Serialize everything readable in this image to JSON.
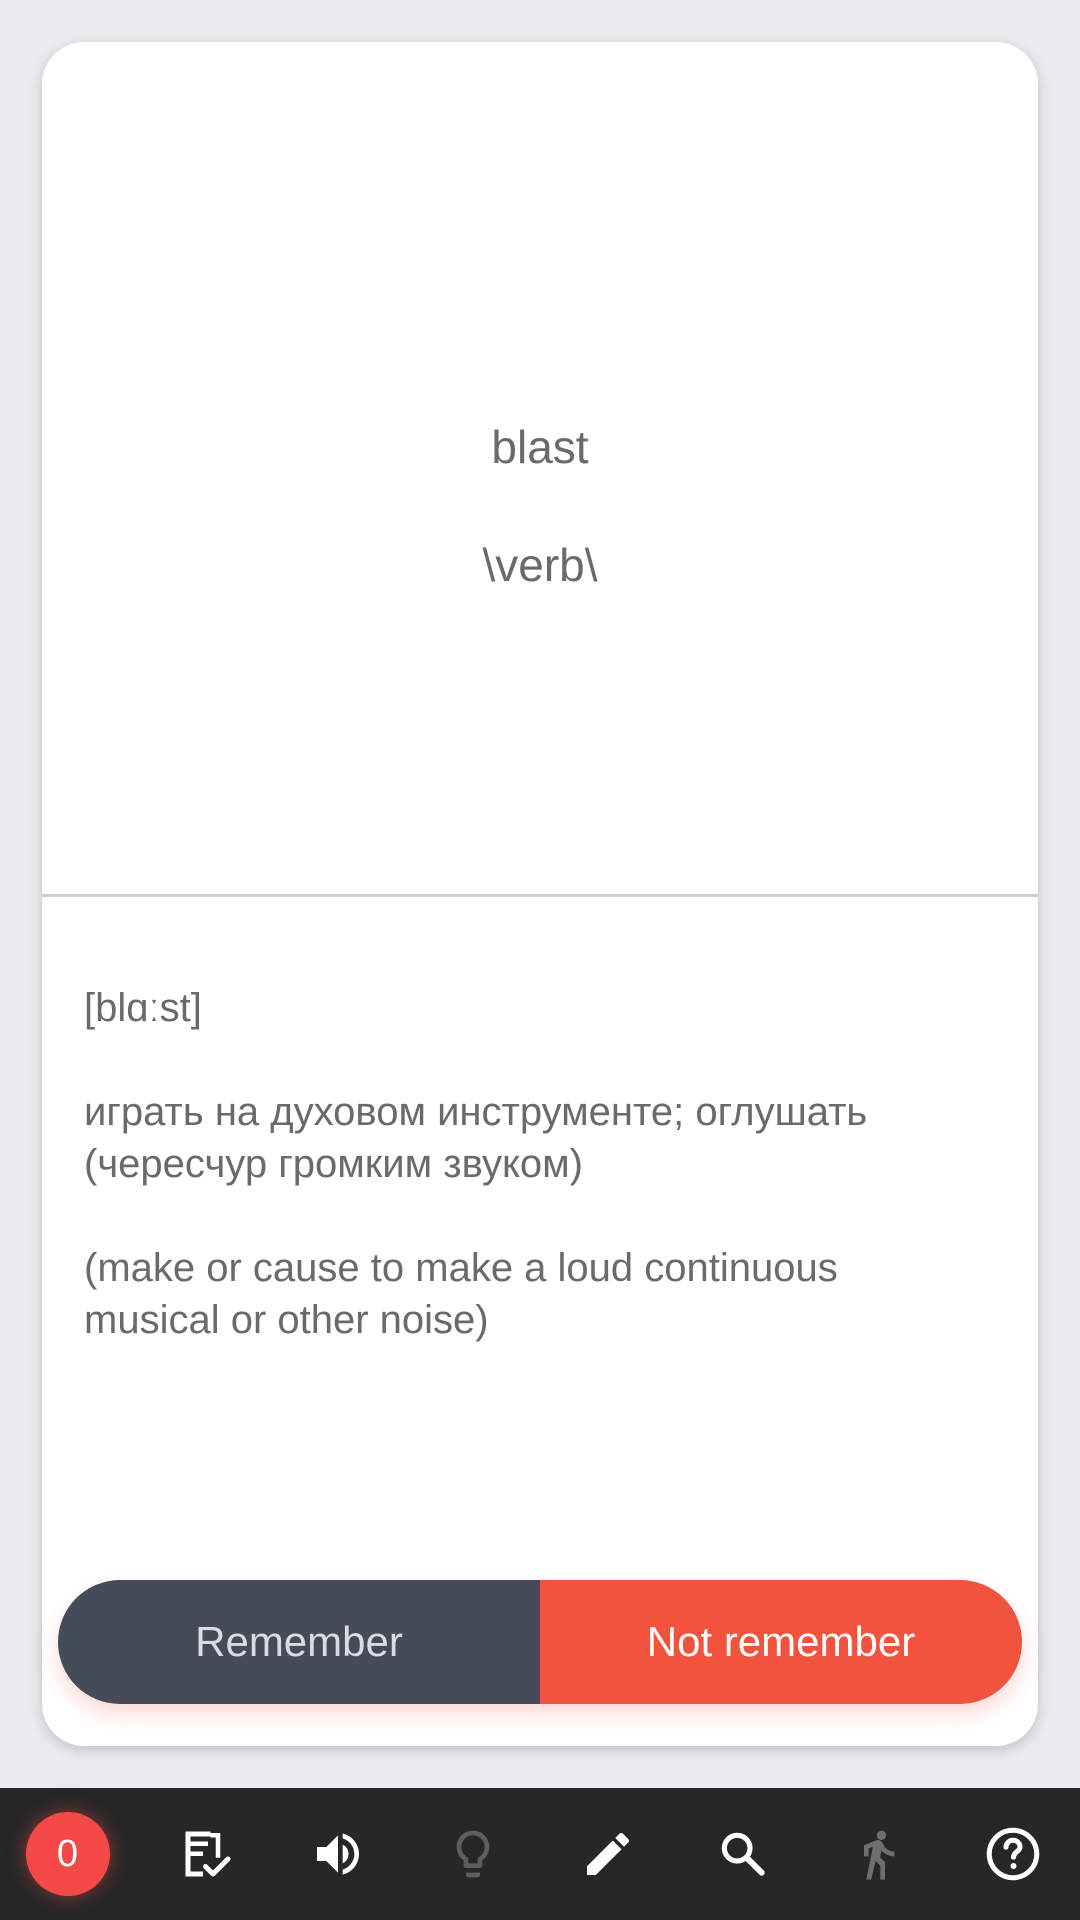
{
  "card": {
    "word": "blast",
    "part_of_speech": "\\verb\\",
    "transcription": "[blɑːst]",
    "translation": "играть на духовом инструменте; оглушать (чересчур громким звуком)",
    "definition": "(make or cause to make a loud continuous musical or other noise)"
  },
  "actions": {
    "remember_label": "Remember",
    "not_remember_label": "Not remember"
  },
  "toolbar": {
    "counter_value": "0",
    "icons": [
      "checklist-icon",
      "volume-icon",
      "lightbulb-icon",
      "pencil-icon",
      "search-icon",
      "walk-icon",
      "help-icon"
    ]
  },
  "colors": {
    "remember_button": "#454c57",
    "not_remember_button": "#f1533f",
    "toolbar_background": "#272727",
    "counter_badge": "#f44a47"
  }
}
